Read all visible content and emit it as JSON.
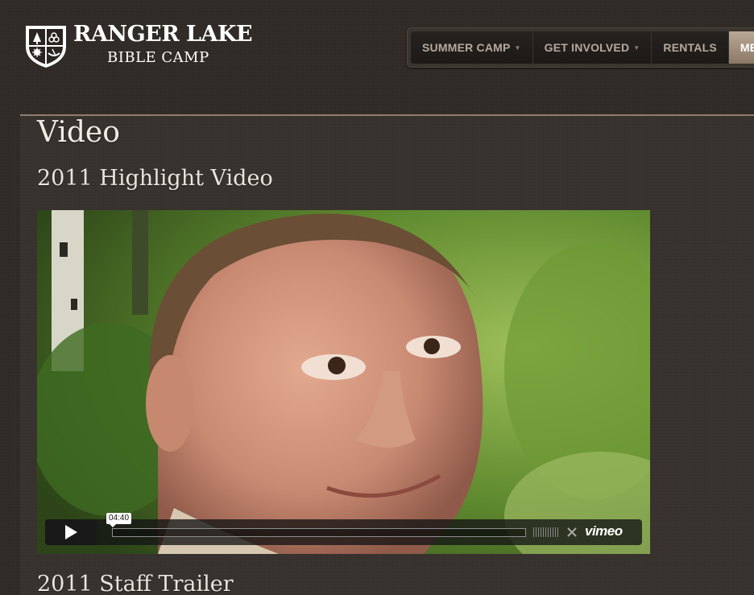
{
  "logo": {
    "title": "RANGER LAKE",
    "subtitle": "BIBLE CAMP"
  },
  "nav": {
    "items": [
      {
        "label": "SUMMER CAMP",
        "has_dropdown": true,
        "active": false
      },
      {
        "label": "GET INVOLVED",
        "has_dropdown": true,
        "active": false
      },
      {
        "label": "RENTALS",
        "has_dropdown": false,
        "active": false
      },
      {
        "label": "MEDIA",
        "has_dropdown": false,
        "active": true
      }
    ],
    "caret": "▼"
  },
  "page": {
    "title": "Video"
  },
  "sections": [
    {
      "title": "2011 Highlight Video"
    },
    {
      "title": "2011 Staff Trailer"
    }
  ],
  "video": {
    "duration": "04:40",
    "provider": "vimeo",
    "progress": 0
  },
  "icons": {
    "logo": "shield-crest-icon",
    "play": "play-icon",
    "volume": "volume-bars-icon",
    "fullscreen": "fullscreen-icon"
  },
  "colors": {
    "background": "#302b27",
    "nav_active": "#a4917f",
    "heading_text": "#f1ebe4"
  }
}
